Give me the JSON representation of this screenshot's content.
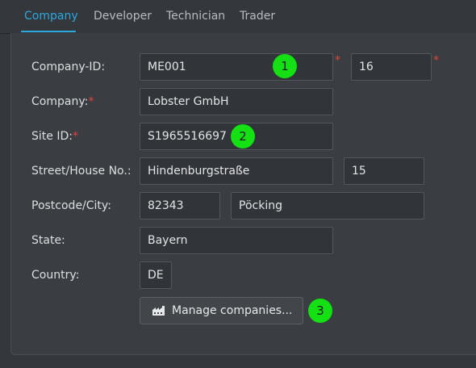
{
  "tabs": [
    {
      "label": "Company"
    },
    {
      "label": "Developer"
    },
    {
      "label": "Technician"
    },
    {
      "label": "Trader"
    }
  ],
  "form": {
    "company_id": {
      "label": "Company-ID:",
      "value": "ME001",
      "suffix_value": "16"
    },
    "company": {
      "label": "Company:",
      "value": "Lobster GmbH"
    },
    "site_id": {
      "label": "Site ID:",
      "value": "S1965516697"
    },
    "street": {
      "label": "Street/House No.:",
      "street_value": "Hindenburgstraße",
      "number_value": "15"
    },
    "postcode": {
      "label": "Postcode/City:",
      "postcode_value": "82343",
      "city_value": "Pöcking"
    },
    "state": {
      "label": "State:",
      "value": "Bayern"
    },
    "country": {
      "label": "Country:",
      "value": "DE"
    }
  },
  "required_mark": "*",
  "manage_button": {
    "label": "Manage companies...",
    "icon": "factory-icon"
  },
  "markers": [
    "1",
    "2",
    "3"
  ],
  "colors": {
    "accent": "#2ea7dc",
    "required": "#e0443a",
    "marker": "#14e014"
  }
}
